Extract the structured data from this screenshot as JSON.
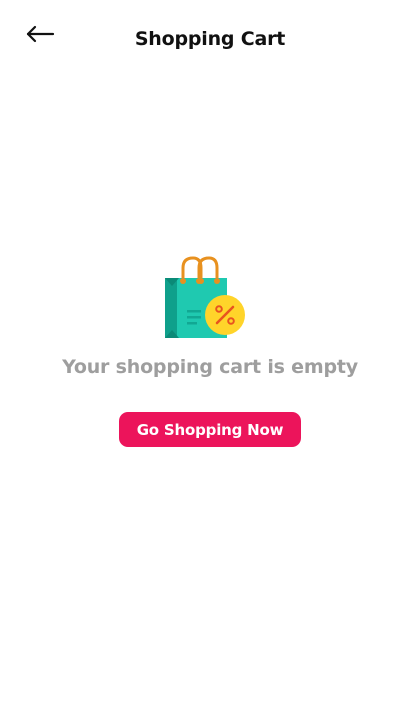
{
  "header": {
    "title": "Shopping Cart",
    "back_icon": "arrow-left-icon"
  },
  "empty_state": {
    "icon": "shopping-bag-discount-icon",
    "message": "Your shopping cart is empty",
    "button_label": "Go Shopping Now"
  },
  "colors": {
    "accent": "#ec145b",
    "bag_teal": "#1fc9b0",
    "bag_teal_dark": "#0fa08b",
    "handle_orange": "#e8911f",
    "badge_yellow": "#ffd42a",
    "muted_text": "#9e9e9e"
  }
}
